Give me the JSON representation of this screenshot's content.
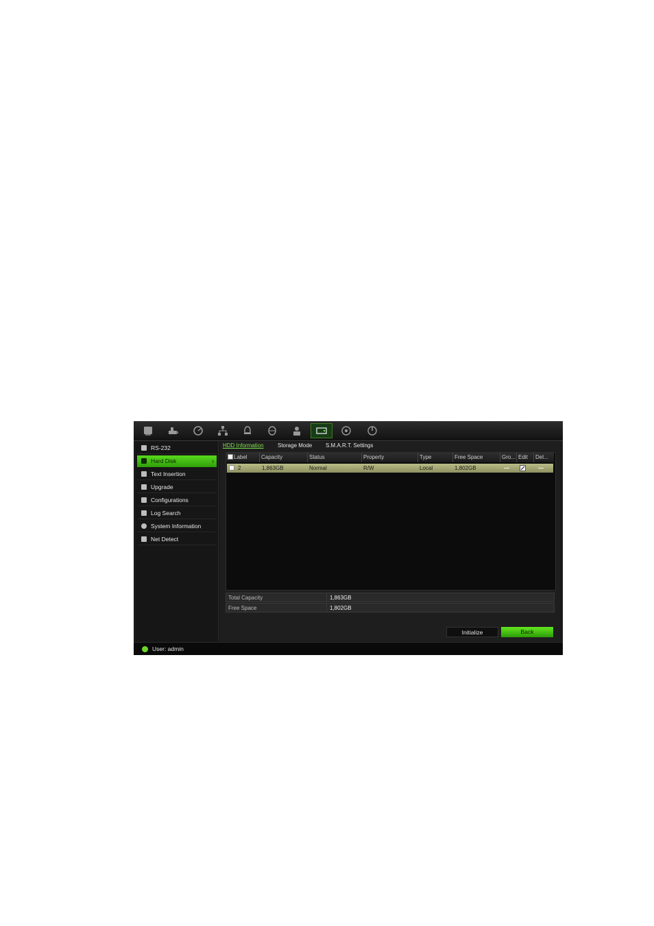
{
  "colors": {
    "accent": "#59d91c",
    "row_highlight": "#b9bc86",
    "background": "#1a1a1a"
  },
  "toolbar": {
    "icons": [
      "monitor-icon",
      "camera-icon",
      "dial-icon",
      "network-icon",
      "alarm-icon",
      "device-icon",
      "user-icon",
      "hdd-icon",
      "help-icon",
      "power-icon"
    ],
    "active_index": 7
  },
  "sidebar": {
    "items": [
      {
        "label": "RS-232",
        "icon": "rs232-icon"
      },
      {
        "label": "Hard Disk",
        "icon": "hard-disk-icon",
        "active": true
      },
      {
        "label": "Text Insertion",
        "icon": "text-insertion-icon"
      },
      {
        "label": "Upgrade",
        "icon": "upgrade-icon"
      },
      {
        "label": "Configurations",
        "icon": "configurations-icon"
      },
      {
        "label": "Log Search",
        "icon": "log-search-icon"
      },
      {
        "label": "System Information",
        "icon": "info-icon"
      },
      {
        "label": "Net Detect",
        "icon": "net-detect-icon"
      }
    ]
  },
  "tabs": [
    "HDD Information",
    "Storage Mode",
    "S.M.A.R.T. Settings"
  ],
  "table": {
    "headers": [
      "Label",
      "Capacity",
      "Status",
      "Property",
      "Type",
      "Free Space",
      "Gro...",
      "Edit",
      "Del..."
    ],
    "rows": [
      {
        "label": "2",
        "capacity": "1,863GB",
        "status": "Normal",
        "property": "R/W",
        "type": "Local",
        "free_space": "1,802GB",
        "group": "—",
        "delete": "—"
      }
    ]
  },
  "summary": [
    {
      "label": "Total Capacity",
      "value": "1,863GB"
    },
    {
      "label": "Free Space",
      "value": "1,802GB"
    }
  ],
  "buttons": {
    "initialize": "Initialize",
    "back": "Back"
  },
  "status": {
    "user": "User: admin"
  }
}
